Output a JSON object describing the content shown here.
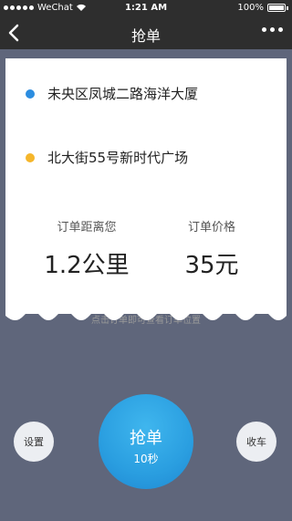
{
  "status": {
    "carrier": "WeChat",
    "time": "1:21 AM",
    "battery": "100%"
  },
  "nav": {
    "title": "抢单"
  },
  "colors": {
    "start_dot": "#2c8de0",
    "end_dot": "#f5b62b",
    "accent": "#2a9ee0"
  },
  "order": {
    "start_address": "未央区凤城二路海洋大厦",
    "end_address": "北大街55号新时代广场",
    "distance_label": "订单距离您",
    "distance_value": "1.2公里",
    "price_label": "订单价格",
    "price_value": "35元",
    "hint": "点击订单即可查看订单位置"
  },
  "actions": {
    "settings": "设置",
    "grab": "抢单",
    "countdown": "10秒",
    "finish": "收车"
  }
}
